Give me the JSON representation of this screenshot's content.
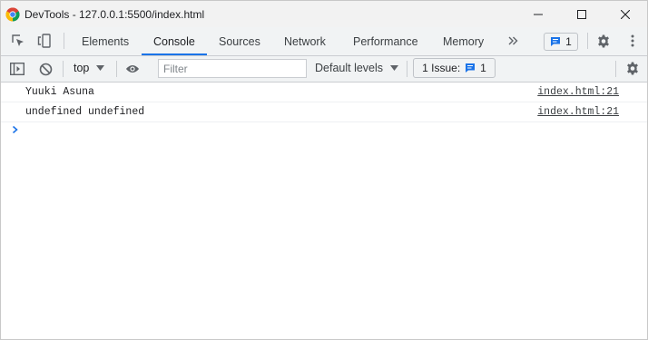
{
  "window": {
    "title": "DevTools - 127.0.0.1:5500/index.html"
  },
  "tabs": [
    {
      "label": "Elements"
    },
    {
      "label": "Console"
    },
    {
      "label": "Sources"
    },
    {
      "label": "Network"
    },
    {
      "label": "Performance"
    },
    {
      "label": "Memory"
    }
  ],
  "tabbar": {
    "more_icon": "double-chevron-right",
    "issues_badge_count": "1"
  },
  "console_toolbar": {
    "context": "top",
    "filter_placeholder": "Filter",
    "levels": "Default levels",
    "issues_label": "1 Issue:",
    "issues_count": "1"
  },
  "messages": [
    {
      "text": "Yuuki Asuna",
      "source": "index.html:21"
    },
    {
      "text": "undefined undefined",
      "source": "index.html:21"
    }
  ],
  "colors": {
    "accent": "#1a73e8",
    "toolbar_bg": "#f1f3f4"
  }
}
